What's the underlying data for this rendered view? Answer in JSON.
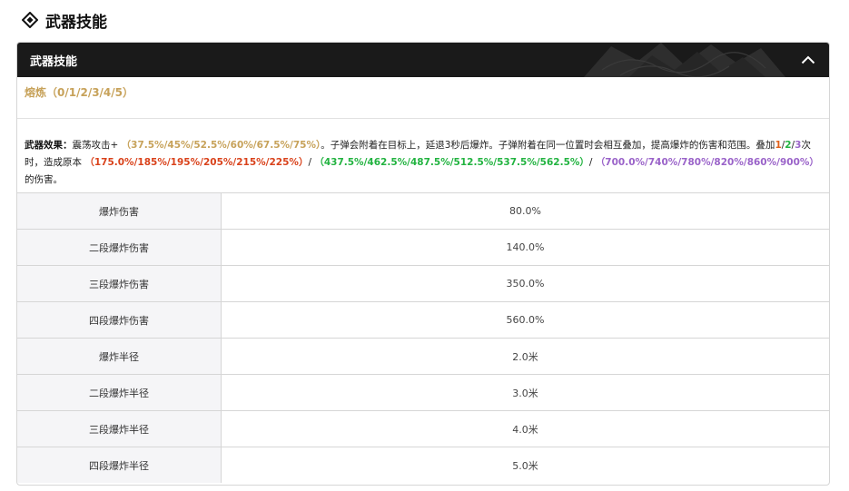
{
  "section": {
    "title": "武器技能",
    "icon": "diamond-icon"
  },
  "panel": {
    "header_title": "武器技能",
    "collapse_icon": "chevron-up-icon",
    "refine_label": "熔炼（0/1/2/3/4/5）",
    "effect": {
      "label": "武器效果：",
      "segments": [
        {
          "text": "震荡攻击+ ",
          "color": "default"
        },
        {
          "text": "（37.5%/45%/52.5%/60%/67.5%/75%）",
          "color": "gold"
        },
        {
          "text": "。子弹会附着在目标上，延退3秒后爆炸。子弹附着在同一位置时会相互叠加，提高爆炸的伤害和范围。叠加",
          "color": "default"
        },
        {
          "text": "1",
          "color": "orange"
        },
        {
          "text": "/",
          "color": "default"
        },
        {
          "text": "2",
          "color": "green"
        },
        {
          "text": "/",
          "color": "default"
        },
        {
          "text": "3",
          "color": "purple"
        },
        {
          "text": "次时，造成原本 ",
          "color": "default"
        },
        {
          "text": "（175.0%/185%/195%/205%/215%/225%）",
          "color": "red"
        },
        {
          "text": "/ ",
          "color": "default"
        },
        {
          "text": "（437.5%/462.5%/487.5%/512.5%/537.5%/562.5%）",
          "color": "green"
        },
        {
          "text": "/ ",
          "color": "default"
        },
        {
          "text": "（700.0%/740%/780%/820%/860%/900%）",
          "color": "purple"
        },
        {
          "text": "的伤害。",
          "color": "default"
        }
      ]
    },
    "colors": {
      "header_bg": "#1a1a1a",
      "gold": "#c7a25a",
      "orange": "#e0601a",
      "red": "#d9421b",
      "green": "#22b340",
      "purple": "#9a63c9"
    },
    "rows": [
      {
        "name": "爆炸伤害",
        "value": "80.0%"
      },
      {
        "name": "二段爆炸伤害",
        "value": "140.0%"
      },
      {
        "name": "三段爆炸伤害",
        "value": "350.0%"
      },
      {
        "name": "四段爆炸伤害",
        "value": "560.0%"
      },
      {
        "name": "爆炸半径",
        "value": "2.0米"
      },
      {
        "name": "二段爆炸半径",
        "value": "3.0米"
      },
      {
        "name": "三段爆炸半径",
        "value": "4.0米"
      },
      {
        "name": "四段爆炸半径",
        "value": "5.0米"
      }
    ]
  }
}
